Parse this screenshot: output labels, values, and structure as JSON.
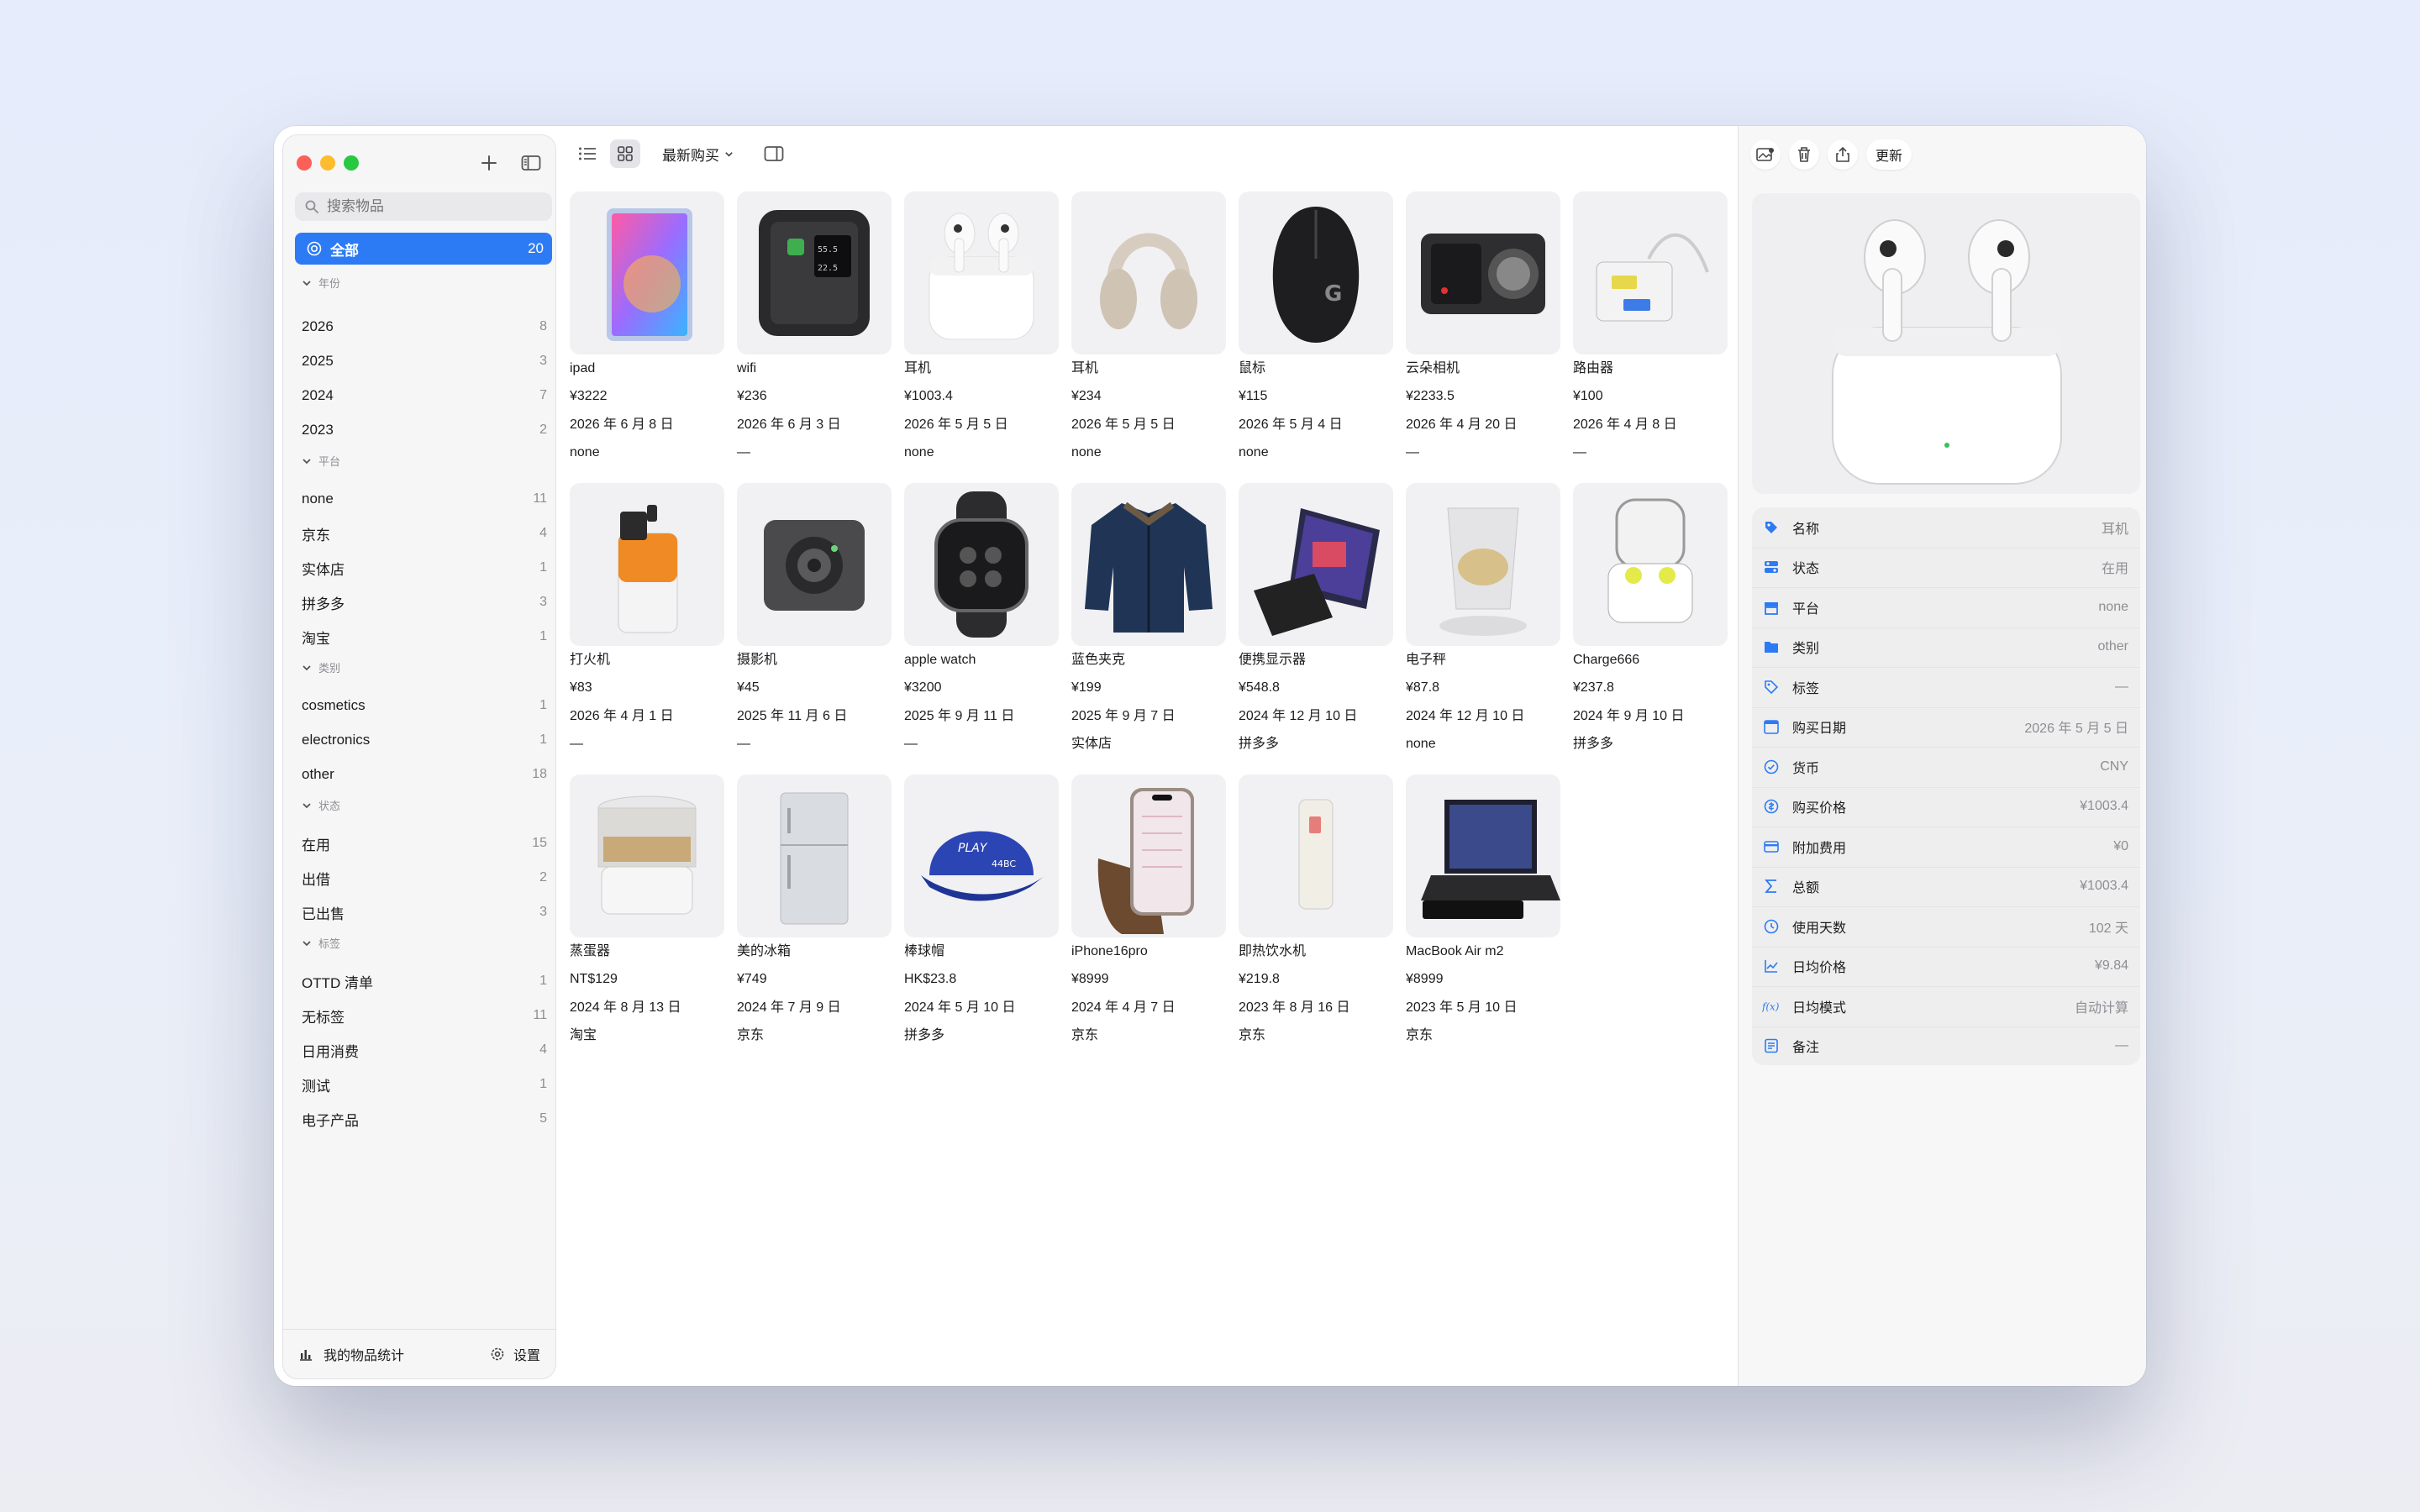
{
  "sidebar": {
    "search_placeholder": "搜索物品",
    "all": {
      "label": "全部",
      "count": "20"
    },
    "sections": {
      "year": {
        "title": "年份",
        "items": [
          {
            "label": "2026",
            "count": "8"
          },
          {
            "label": "2025",
            "count": "3"
          },
          {
            "label": "2024",
            "count": "7"
          },
          {
            "label": "2023",
            "count": "2"
          }
        ]
      },
      "platform": {
        "title": "平台",
        "items": [
          {
            "label": "none",
            "count": "11"
          },
          {
            "label": "京东",
            "count": "4"
          },
          {
            "label": "实体店",
            "count": "1"
          },
          {
            "label": "拼多多",
            "count": "3"
          },
          {
            "label": "淘宝",
            "count": "1"
          }
        ]
      },
      "category": {
        "title": "类别",
        "items": [
          {
            "label": "cosmetics",
            "count": "1"
          },
          {
            "label": "electronics",
            "count": "1"
          },
          {
            "label": "other",
            "count": "18"
          }
        ]
      },
      "status": {
        "title": "状态",
        "items": [
          {
            "label": "在用",
            "count": "15"
          },
          {
            "label": "出借",
            "count": "2"
          },
          {
            "label": "已出售",
            "count": "3"
          }
        ]
      },
      "tags": {
        "title": "标签",
        "items": [
          {
            "label": "OTTD 清单",
            "count": "1"
          },
          {
            "label": "无标签",
            "count": "11"
          },
          {
            "label": "日用消费",
            "count": "4"
          },
          {
            "label": "测试",
            "count": "1"
          },
          {
            "label": "电子产品",
            "count": "5"
          }
        ]
      }
    },
    "footer": {
      "stats_label": "我的物品统计",
      "settings_label": "设置"
    }
  },
  "toolbar": {
    "sort_label": "最新购买"
  },
  "items": [
    {
      "name": "ipad",
      "price": "¥3222",
      "date": "2026 年 6 月 8 日",
      "platform": "none",
      "icon": "ipad"
    },
    {
      "name": "wifi",
      "price": "¥236",
      "date": "2026 年 6 月 3 日",
      "platform": "—",
      "icon": "wifi-device"
    },
    {
      "name": "耳机",
      "price": "¥1003.4",
      "date": "2026 年 5 月 5 日",
      "platform": "none",
      "icon": "airpods"
    },
    {
      "name": "耳机",
      "price": "¥234",
      "date": "2026 年 5 月 5 日",
      "platform": "none",
      "icon": "headphones"
    },
    {
      "name": "鼠标",
      "price": "¥115",
      "date": "2026 年 5 月 4 日",
      "platform": "none",
      "icon": "mouse"
    },
    {
      "name": "云朵相机",
      "price": "¥2233.5",
      "date": "2026 年 4 月 20 日",
      "platform": "—",
      "icon": "camera"
    },
    {
      "name": "路由器",
      "price": "¥100",
      "date": "2026 年 4 月 8 日",
      "platform": "—",
      "icon": "router"
    },
    {
      "name": "打火机",
      "price": "¥83",
      "date": "2026 年 4 月 1 日",
      "platform": "—",
      "icon": "lighter"
    },
    {
      "name": "摄影机",
      "price": "¥45",
      "date": "2025 年 11 月 6 日",
      "platform": "—",
      "icon": "webcam"
    },
    {
      "name": "apple watch",
      "price": "¥3200",
      "date": "2025 年 9 月 11 日",
      "platform": "—",
      "icon": "watch"
    },
    {
      "name": "蓝色夹克",
      "price": "¥199",
      "date": "2025 年 9 月 7 日",
      "platform": "实体店",
      "icon": "jacket"
    },
    {
      "name": "便携显示器",
      "price": "¥548.8",
      "date": "2024 年 12 月 10 日",
      "platform": "拼多多",
      "icon": "monitor"
    },
    {
      "name": "电子秤",
      "price": "¥87.8",
      "date": "2024 年 12 月 10 日",
      "platform": "none",
      "icon": "scale"
    },
    {
      "name": "Charge666",
      "price": "¥237.8",
      "date": "2024 年 9 月 10 日",
      "platform": "拼多多",
      "icon": "charger"
    },
    {
      "name": "蒸蛋器",
      "price": "NT$129",
      "date": "2024 年 8 月 13 日",
      "platform": "淘宝",
      "icon": "steamer"
    },
    {
      "name": "美的冰箱",
      "price": "¥749",
      "date": "2024 年 7 月 9 日",
      "platform": "京东",
      "icon": "fridge"
    },
    {
      "name": "棒球帽",
      "price": "HK$23.8",
      "date": "2024 年 5 月 10 日",
      "platform": "拼多多",
      "icon": "cap"
    },
    {
      "name": "iPhone16pro",
      "price": "¥8999",
      "date": "2024 年 4 月 7 日",
      "platform": "京东",
      "icon": "phone"
    },
    {
      "name": "即热饮水机",
      "price": "¥219.8",
      "date": "2023 年 8 月 16 日",
      "platform": "京东",
      "icon": "water-dispenser"
    },
    {
      "name": "MacBook Air m2",
      "price": "¥8999",
      "date": "2023 年 5 月 10 日",
      "platform": "京东",
      "icon": "laptop"
    }
  ],
  "detail": {
    "update_label": "更新",
    "properties": [
      {
        "label": "名称",
        "value": "耳机",
        "icon": "tag-fill-icon"
      },
      {
        "label": "状态",
        "value": "在用",
        "icon": "status-icon"
      },
      {
        "label": "平台",
        "value": "none",
        "icon": "store-icon"
      },
      {
        "label": "类别",
        "value": "other",
        "icon": "folder-icon"
      },
      {
        "label": "标签",
        "value": "—",
        "icon": "tag-icon"
      },
      {
        "label": "购买日期",
        "value": "2026 年 5 月 5 日",
        "icon": "calendar-icon"
      },
      {
        "label": "货币",
        "value": "CNY",
        "icon": "currency-icon"
      },
      {
        "label": "购买价格",
        "value": "¥1003.4",
        "icon": "price-icon"
      },
      {
        "label": "附加费用",
        "value": "¥0",
        "icon": "card-icon"
      },
      {
        "label": "总额",
        "value": "¥1003.4",
        "icon": "sigma-icon"
      },
      {
        "label": "使用天数",
        "value": "102 天",
        "icon": "clock-icon"
      },
      {
        "label": "日均价格",
        "value": "¥9.84",
        "icon": "chart-icon"
      },
      {
        "label": "日均模式",
        "value": "自动计算",
        "icon": "function-icon"
      },
      {
        "label": "备注",
        "value": "—",
        "icon": "note-icon"
      }
    ]
  },
  "colors": {
    "accent": "#2d7bf4",
    "icon_accent": "#2d7bf4"
  }
}
